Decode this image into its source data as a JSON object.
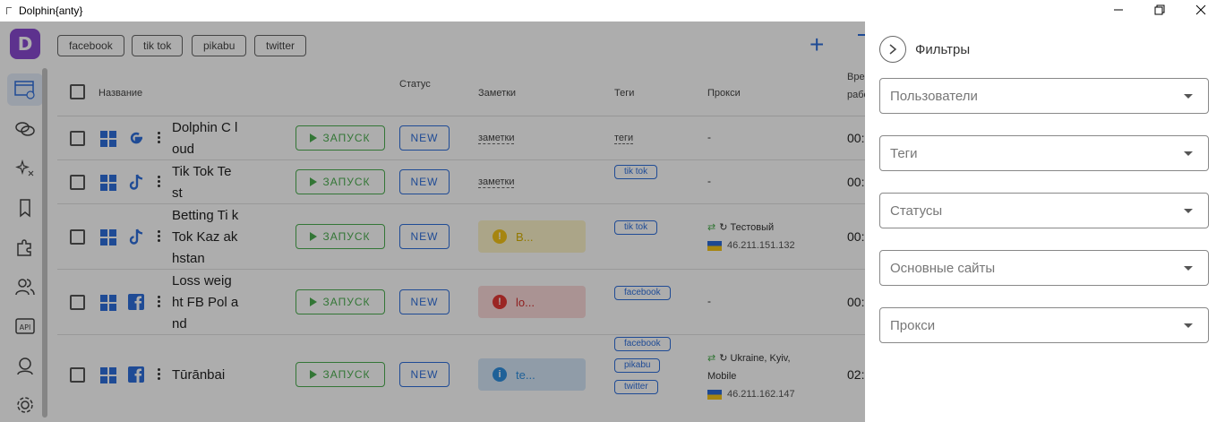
{
  "window": {
    "title": "Dolphin{anty}"
  },
  "toolbar": {
    "tag_filters": [
      "facebook",
      "tik tok",
      "pikabu",
      "twitter"
    ],
    "add_label": "+"
  },
  "table": {
    "headers": {
      "name": "Название",
      "status": "Статус",
      "notes": "Заметки",
      "tags": "Теги",
      "proxy": "Прокси",
      "work_time_a": "Время",
      "work_time_b": "рабо"
    },
    "run_label": "ЗАПУСК",
    "status_label": "NEW",
    "rows": [
      {
        "name": "Dolphin C loud",
        "site_icon": "google-icon",
        "note": "заметки",
        "tag": "теги",
        "proxy": "-",
        "time": "00:"
      },
      {
        "name": "Tik Tok Te st",
        "site_icon": "tiktok-icon",
        "note": "заметки",
        "tags": [
          "tik tok"
        ],
        "proxy": "-",
        "time": "00:"
      },
      {
        "name": "Betting Ti k Tok Kaz akhstan",
        "site_icon": "tiktok-icon",
        "note_box": "B...",
        "tags": [
          "tik tok"
        ],
        "proxy_name": "Тестовый",
        "proxy_ip": "46.211.151.132",
        "time": "00:"
      },
      {
        "name": "Loss weig ht FB Pol and",
        "site_icon": "facebook-icon",
        "note_box": "lo...",
        "tags": [
          "facebook"
        ],
        "proxy": "-",
        "time": "00:"
      },
      {
        "name": "Tūrānbai",
        "site_icon": "facebook-icon",
        "note_box": "te...",
        "tags": [
          "facebook",
          "pikabu",
          "twitter"
        ],
        "proxy_name": "Ukraine, Kyiv,",
        "proxy_name2": "Mobile",
        "proxy_ip": "46.211.162.147",
        "time": "02:"
      }
    ]
  },
  "filters": {
    "title": "Фильтры",
    "fields": [
      "Пользователи",
      "Теги",
      "Статусы",
      "Основные сайты",
      "Прокси"
    ]
  },
  "colors": {
    "accent": "#2f6fdc",
    "run": "#4caf50",
    "logo": "#8a4bd1",
    "note_warn": "#f5c518",
    "note_error": "#e53935",
    "note_info": "#2f8fe0"
  }
}
